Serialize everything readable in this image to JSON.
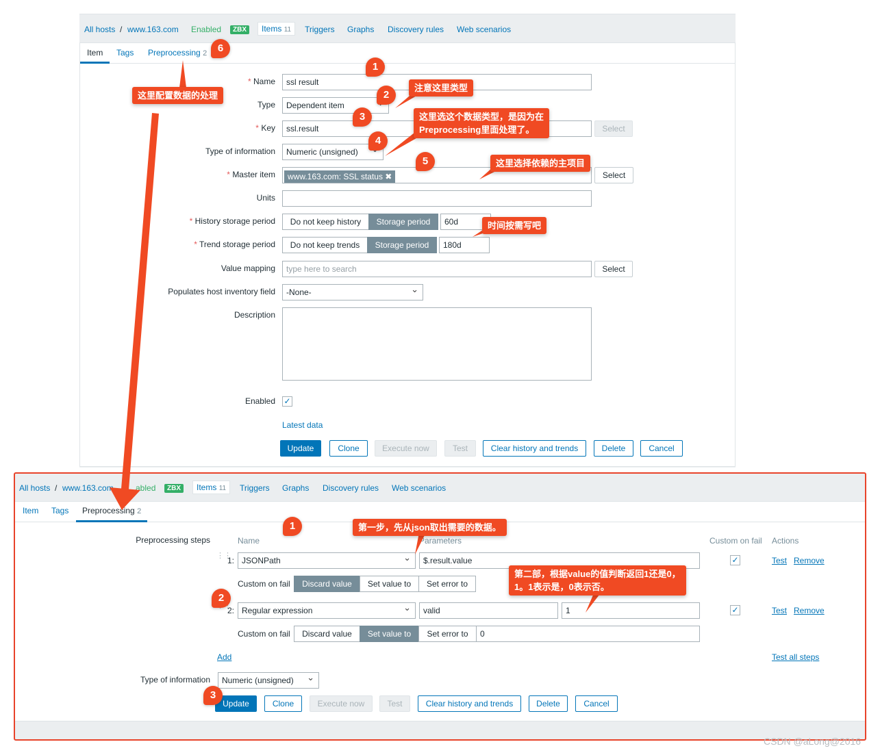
{
  "top": {
    "nav": {
      "all_hosts": "All hosts",
      "sep": "/",
      "host": "www.163.com",
      "enabled": "Enabled",
      "zbx": "ZBX",
      "items": "Items",
      "items_count": "11",
      "triggers": "Triggers",
      "graphs": "Graphs",
      "discovery": "Discovery rules",
      "web": "Web scenarios"
    },
    "tabs": {
      "item": "Item",
      "tags": "Tags",
      "preprocessing": "Preprocessing",
      "pre_count": "2"
    },
    "form": {
      "name_label": "Name",
      "name_value": "ssl result",
      "type_label": "Type",
      "type_value": "Dependent item",
      "key_label": "Key",
      "key_value": "ssl.result",
      "key_select": "Select",
      "toi_label": "Type of information",
      "toi_value": "Numeric (unsigned)",
      "master_label": "Master item",
      "master_value": "www.163.com: SSL status",
      "master_select": "Select",
      "units_label": "Units",
      "history_label": "History storage period",
      "history_no": "Do not keep history",
      "history_storage": "Storage period",
      "history_value": "60d",
      "trend_label": "Trend storage period",
      "trend_no": "Do not keep trends",
      "trend_storage": "Storage period",
      "trend_value": "180d",
      "vm_label": "Value mapping",
      "vm_placeholder": "type here to search",
      "vm_select": "Select",
      "inv_label": "Populates host inventory field",
      "inv_value": "-None-",
      "desc_label": "Description",
      "enabled_label": "Enabled",
      "enabled_checked": true,
      "latest_data": "Latest data"
    },
    "buttons": {
      "update": "Update",
      "clone": "Clone",
      "execute": "Execute now",
      "test": "Test",
      "clear": "Clear history and trends",
      "delete": "Delete",
      "cancel": "Cancel"
    }
  },
  "bottom": {
    "nav": {
      "all_hosts": "All hosts",
      "sep": "/",
      "host": "www.163.com",
      "enabled": "abled",
      "zbx": "ZBX",
      "items": "Items",
      "items_count": "11",
      "triggers": "Triggers",
      "graphs": "Graphs",
      "discovery": "Discovery rules",
      "web": "Web scenarios"
    },
    "tabs": {
      "item": "Item",
      "tags": "Tags",
      "preprocessing": "Preprocessing",
      "pre_count": "2"
    },
    "steps_label": "Preprocessing steps",
    "headers": {
      "name": "Name",
      "params": "Parameters",
      "custom": "Custom on fail",
      "actions": "Actions"
    },
    "steps": [
      {
        "num": "1:",
        "name": "JSONPath",
        "param1": "$.result.value",
        "custom_checked": true,
        "test": "Test",
        "remove": "Remove",
        "cof_label": "Custom on fail",
        "discard": "Discard value",
        "set_value": "Set value to",
        "set_error": "Set error to",
        "selected": "Discard value"
      },
      {
        "num": "2:",
        "name": "Regular expression",
        "param1": "valid",
        "param2": "1",
        "custom_checked": true,
        "test": "Test",
        "remove": "Remove",
        "cof_label": "Custom on fail",
        "discard": "Discard value",
        "set_value": "Set value to",
        "set_error": "Set error to",
        "selected": "Set value to",
        "cof_value": "0"
      }
    ],
    "add": "Add",
    "test_all": "Test all steps",
    "toi_label": "Type of information",
    "toi_value": "Numeric (unsigned)",
    "buttons": {
      "update": "Update",
      "clone": "Clone",
      "execute": "Execute now",
      "test": "Test",
      "clear": "Clear history and trends",
      "delete": "Delete",
      "cancel": "Cancel"
    }
  },
  "annotations": {
    "c_pre": "这里配置数据的处理",
    "c_type": "注意这里类型",
    "c_toi_1": "这里选这个数据类型，是因为在",
    "c_toi_2": "Preprocessing里面处理了。",
    "c_master": "这里选择依赖的主项目",
    "c_time": "时间按需写吧",
    "c_step1": "第一步，先从json取出需要的数据。",
    "c_step2_1": "第二部，根据value的值判断返回1还是0，",
    "c_step2_2": "1。1表示是，0表示否。",
    "b1": "1",
    "b2": "2",
    "b3": "3",
    "b4": "4",
    "b5": "5",
    "b6": "6",
    "bb1": "1",
    "bb2": "2",
    "bb3": "3",
    "color": "#f04a23"
  },
  "watermark": "CSDN @aLong@2016"
}
